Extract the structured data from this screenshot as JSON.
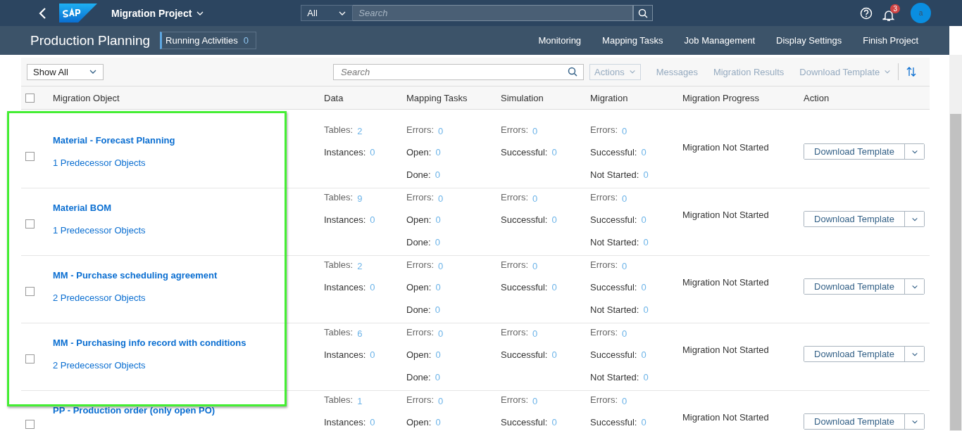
{
  "shell": {
    "app_title": "Migration Project",
    "scope": "All",
    "search_placeholder": "Search",
    "notifications": "3",
    "avatar": "a"
  },
  "header": {
    "title": "Production Planning",
    "running_label": "Running Activities",
    "running_count": "0",
    "links": [
      "Monitoring",
      "Mapping Tasks",
      "Job Management",
      "Display Settings",
      "Finish Project"
    ]
  },
  "toolbar": {
    "filter": "Show All",
    "search_placeholder": "Search",
    "actions": [
      {
        "label": "Actions",
        "kind": "menu",
        "disabled": true
      },
      {
        "label": "Messages",
        "kind": "link",
        "disabled": true
      },
      {
        "label": "Migration Results",
        "kind": "link",
        "disabled": true
      },
      {
        "label": "Download Template",
        "kind": "dropdown",
        "disabled": true
      }
    ]
  },
  "table": {
    "select_all_checked": false,
    "columns": [
      "Migration Object",
      "Data",
      "Mapping Tasks",
      "Simulation",
      "Migration",
      "Migration Progress",
      "Action"
    ],
    "rows": [
      {
        "name": "Material - Forecast Planning",
        "predecessors": "1 Predecessor Objects",
        "checked": false,
        "data": [
          {
            "label": "Tables:",
            "value": "2"
          },
          {
            "label": "Instances:",
            "value": "0"
          }
        ],
        "mapping": [
          {
            "label": "Errors:",
            "value": "0"
          },
          {
            "label": "Open:",
            "value": "0"
          },
          {
            "label": "Done:",
            "value": "0"
          }
        ],
        "simulation": [
          {
            "label": "Errors:",
            "value": "0"
          },
          {
            "label": "Successful:",
            "value": "0"
          }
        ],
        "migration": [
          {
            "label": "Errors:",
            "value": "0"
          },
          {
            "label": "Successful:",
            "value": "0"
          },
          {
            "label": "Not Started:",
            "value": "0"
          }
        ],
        "progress": "Migration Not Started",
        "action": "Download Template"
      },
      {
        "name": "Material BOM",
        "predecessors": "1 Predecessor Objects",
        "checked": false,
        "data": [
          {
            "label": "Tables:",
            "value": "9"
          },
          {
            "label": "Instances:",
            "value": "0"
          }
        ],
        "mapping": [
          {
            "label": "Errors:",
            "value": "0"
          },
          {
            "label": "Open:",
            "value": "0"
          },
          {
            "label": "Done:",
            "value": "0"
          }
        ],
        "simulation": [
          {
            "label": "Errors:",
            "value": "0"
          },
          {
            "label": "Successful:",
            "value": "0"
          }
        ],
        "migration": [
          {
            "label": "Errors:",
            "value": "0"
          },
          {
            "label": "Successful:",
            "value": "0"
          },
          {
            "label": "Not Started:",
            "value": "0"
          }
        ],
        "progress": "Migration Not Started",
        "action": "Download Template"
      },
      {
        "name": "MM - Purchase scheduling agreement",
        "predecessors": "2 Predecessor Objects",
        "checked": false,
        "data": [
          {
            "label": "Tables:",
            "value": "2"
          },
          {
            "label": "Instances:",
            "value": "0"
          }
        ],
        "mapping": [
          {
            "label": "Errors:",
            "value": "0"
          },
          {
            "label": "Open:",
            "value": "0"
          },
          {
            "label": "Done:",
            "value": "0"
          }
        ],
        "simulation": [
          {
            "label": "Errors:",
            "value": "0"
          },
          {
            "label": "Successful:",
            "value": "0"
          }
        ],
        "migration": [
          {
            "label": "Errors:",
            "value": "0"
          },
          {
            "label": "Successful:",
            "value": "0"
          },
          {
            "label": "Not Started:",
            "value": "0"
          }
        ],
        "progress": "Migration Not Started",
        "action": "Download Template"
      },
      {
        "name": "MM - Purchasing info record with conditions",
        "predecessors": "2 Predecessor Objects",
        "checked": false,
        "data": [
          {
            "label": "Tables:",
            "value": "6"
          },
          {
            "label": "Instances:",
            "value": "0"
          }
        ],
        "mapping": [
          {
            "label": "Errors:",
            "value": "0"
          },
          {
            "label": "Open:",
            "value": "0"
          },
          {
            "label": "Done:",
            "value": "0"
          }
        ],
        "simulation": [
          {
            "label": "Errors:",
            "value": "0"
          },
          {
            "label": "Successful:",
            "value": "0"
          }
        ],
        "migration": [
          {
            "label": "Errors:",
            "value": "0"
          },
          {
            "label": "Successful:",
            "value": "0"
          },
          {
            "label": "Not Started:",
            "value": "0"
          }
        ],
        "progress": "Migration Not Started",
        "action": "Download Template"
      },
      {
        "name": "PP - Production order (only open PO)",
        "checked": false,
        "data": [
          {
            "label": "Tables:",
            "value": "1"
          },
          {
            "label": "Instances:",
            "value": "0"
          }
        ],
        "mapping": [
          {
            "label": "Errors:",
            "value": "0"
          },
          {
            "label": "Open:",
            "value": "0"
          }
        ],
        "simulation": [
          {
            "label": "Errors:",
            "value": "0"
          },
          {
            "label": "Successful:",
            "value": "0"
          }
        ],
        "migration": [
          {
            "label": "Errors:",
            "value": "0"
          },
          {
            "label": "Successful:",
            "value": "0"
          }
        ],
        "progress": "Migration Not Started",
        "action": "Download Template"
      }
    ]
  },
  "highlight": {
    "visible": true
  }
}
